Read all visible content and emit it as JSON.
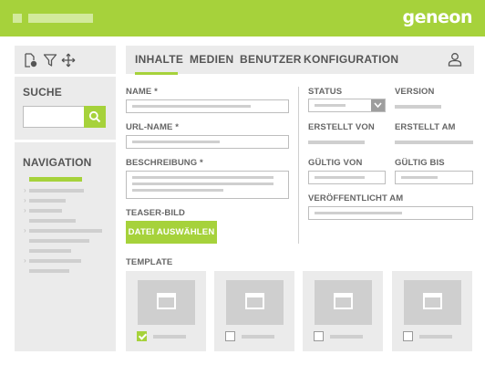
{
  "brand": {
    "logo_text": "geneon",
    "accent": "#a6d23b"
  },
  "sidebar": {
    "tools": [
      "new-file-icon",
      "filter-icon",
      "move-icon"
    ],
    "search": {
      "title": "SUCHE",
      "value": "",
      "button_icon": "search-icon"
    },
    "navigation": {
      "title": "NAVIGATION",
      "items_count_visible": 10
    }
  },
  "tabs": [
    {
      "label": "INHALTE",
      "active": true
    },
    {
      "label": "MEDIEN",
      "active": false
    },
    {
      "label": "BENUTZER",
      "active": false
    },
    {
      "label": "KONFIGURATION",
      "active": false
    }
  ],
  "form": {
    "name_label": "NAME *",
    "urlname_label": "URL-NAME *",
    "description_label": "BESCHREIBUNG *",
    "teaser_label": "TEASER-BILD",
    "file_button_label": "DATEI AUSWÄHLEN",
    "template_label": "TEMPLATE"
  },
  "meta": {
    "status_label": "STATUS",
    "version_label": "VERSION",
    "created_by_label": "ERSTELLT VON",
    "created_at_label": "ERSTELLT AM",
    "valid_from_label": "GÜLTIG VON",
    "valid_to_label": "GÜLTIG  BIS",
    "published_label": "VERÖFFENTLICHT AM"
  },
  "templates": [
    {
      "checked": true
    },
    {
      "checked": false
    },
    {
      "checked": false
    },
    {
      "checked": false
    }
  ]
}
